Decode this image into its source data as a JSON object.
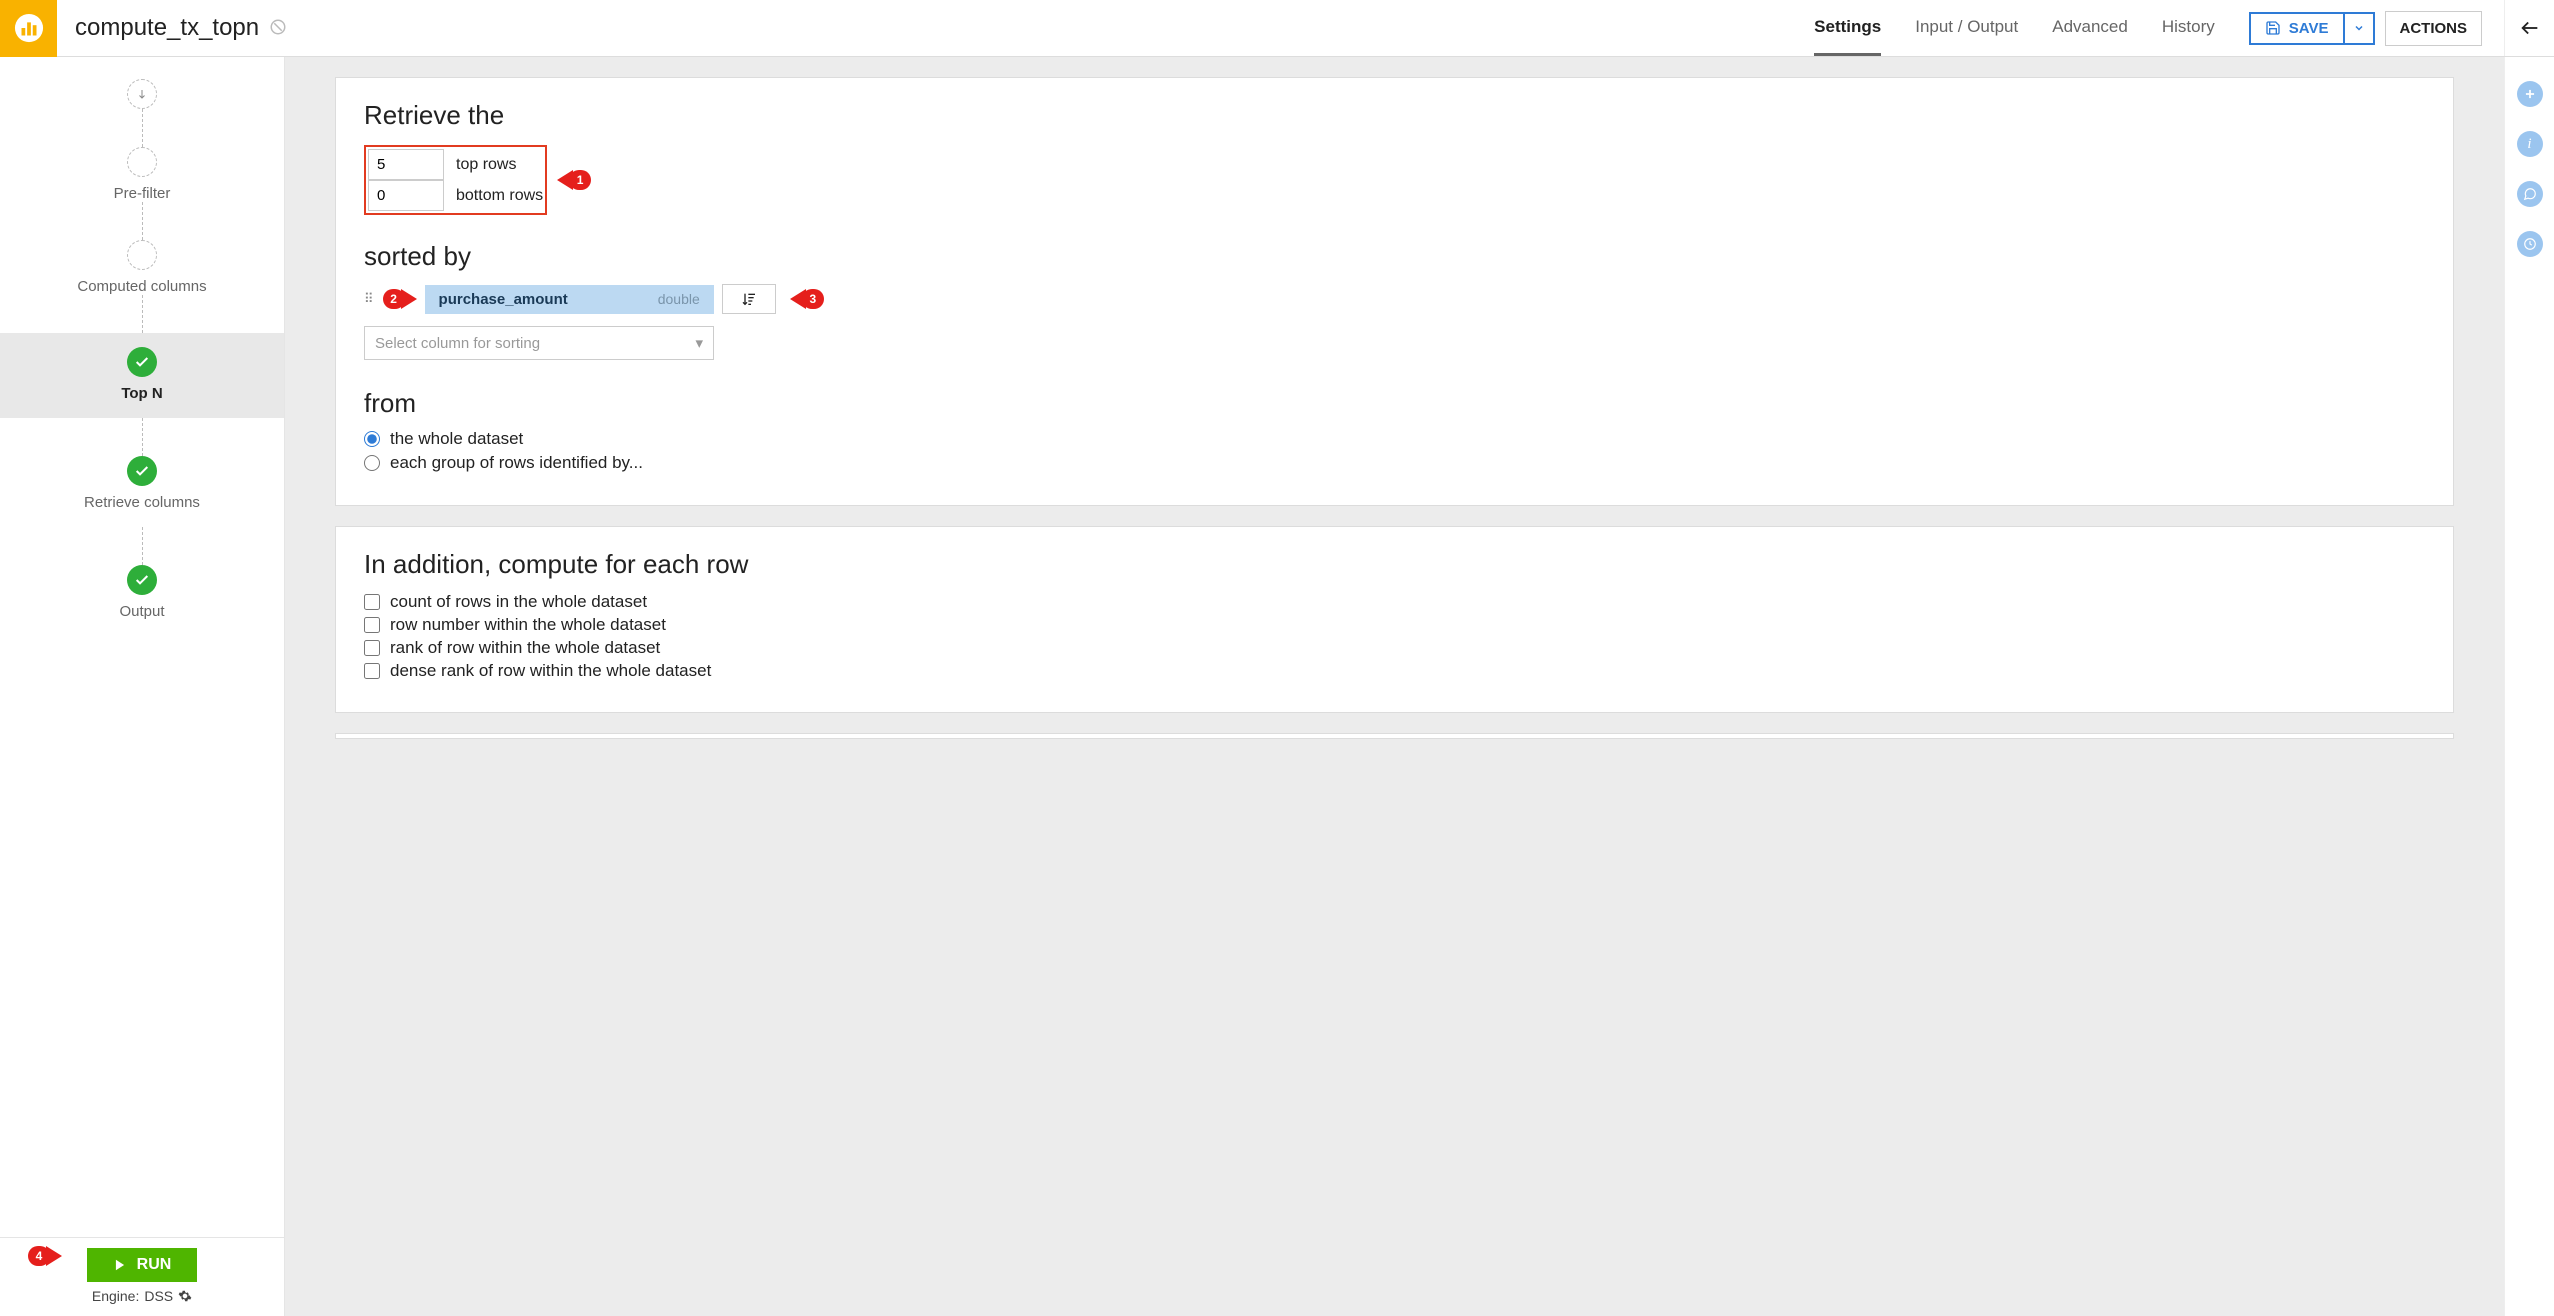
{
  "header": {
    "title": "compute_tx_topn",
    "tabs": [
      "Settings",
      "Input / Output",
      "Advanced",
      "History"
    ],
    "active_tab": "Settings",
    "save_label": "SAVE",
    "actions_label": "ACTIONS"
  },
  "sidebar_steps": {
    "prefilter": "Pre-filter",
    "computed": "Computed columns",
    "topn": "Top N",
    "retrieve": "Retrieve columns",
    "output": "Output"
  },
  "footer": {
    "run_label": "RUN",
    "engine_prefix": "Engine: ",
    "engine_name": "DSS"
  },
  "retrieve": {
    "heading": "Retrieve the",
    "top_value": "5",
    "top_label": "top rows",
    "bottom_value": "0",
    "bottom_label": "bottom rows"
  },
  "sorted": {
    "heading": "sorted by",
    "column": "purchase_amount",
    "column_type": "double",
    "placeholder": "Select column for sorting"
  },
  "from": {
    "heading": "from",
    "opt_whole": "the whole dataset",
    "opt_group": "each group of rows identified by..."
  },
  "compute": {
    "heading": "In addition, compute for each row",
    "opts": [
      "count of rows in the whole dataset",
      "row number within the whole dataset",
      "rank of row within the whole dataset",
      "dense rank of row within the whole dataset"
    ]
  },
  "annotations": {
    "c1": "1",
    "c2": "2",
    "c3": "3",
    "c4": "4"
  }
}
